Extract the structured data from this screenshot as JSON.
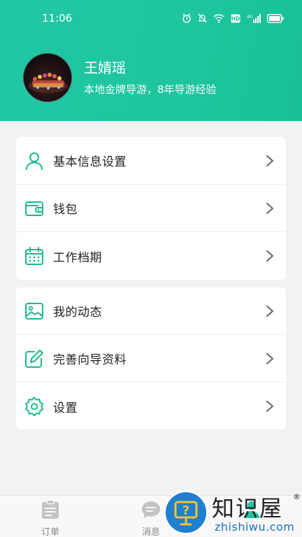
{
  "status_bar": {
    "time": "11:06",
    "icons": [
      "alarm-icon",
      "mute-bell-icon",
      "wifi-icon",
      "hd-icon",
      "signal-4g-icon",
      "battery-icon"
    ]
  },
  "profile": {
    "name": "王婧瑶",
    "description": "本地金牌导游，8年导游经验"
  },
  "menu_group_1": [
    {
      "label": "基本信息设置",
      "icon": "person-icon"
    },
    {
      "label": "钱包",
      "icon": "wallet-icon"
    },
    {
      "label": "工作档期",
      "icon": "calendar-icon"
    }
  ],
  "menu_group_2": [
    {
      "label": "我的动态",
      "icon": "image-icon"
    },
    {
      "label": "完善向导资料",
      "icon": "edit-icon"
    },
    {
      "label": "设置",
      "icon": "gear-icon"
    }
  ],
  "tab_bar": {
    "orders": "订单",
    "messages": "消息"
  },
  "watermark": {
    "title": "知识屋",
    "url": "zhishiwu.com",
    "registered": "®"
  },
  "colors": {
    "accent": "#1ec59e",
    "icon_green": "#19b98f",
    "watermark_blue": "#1f7fd0"
  }
}
